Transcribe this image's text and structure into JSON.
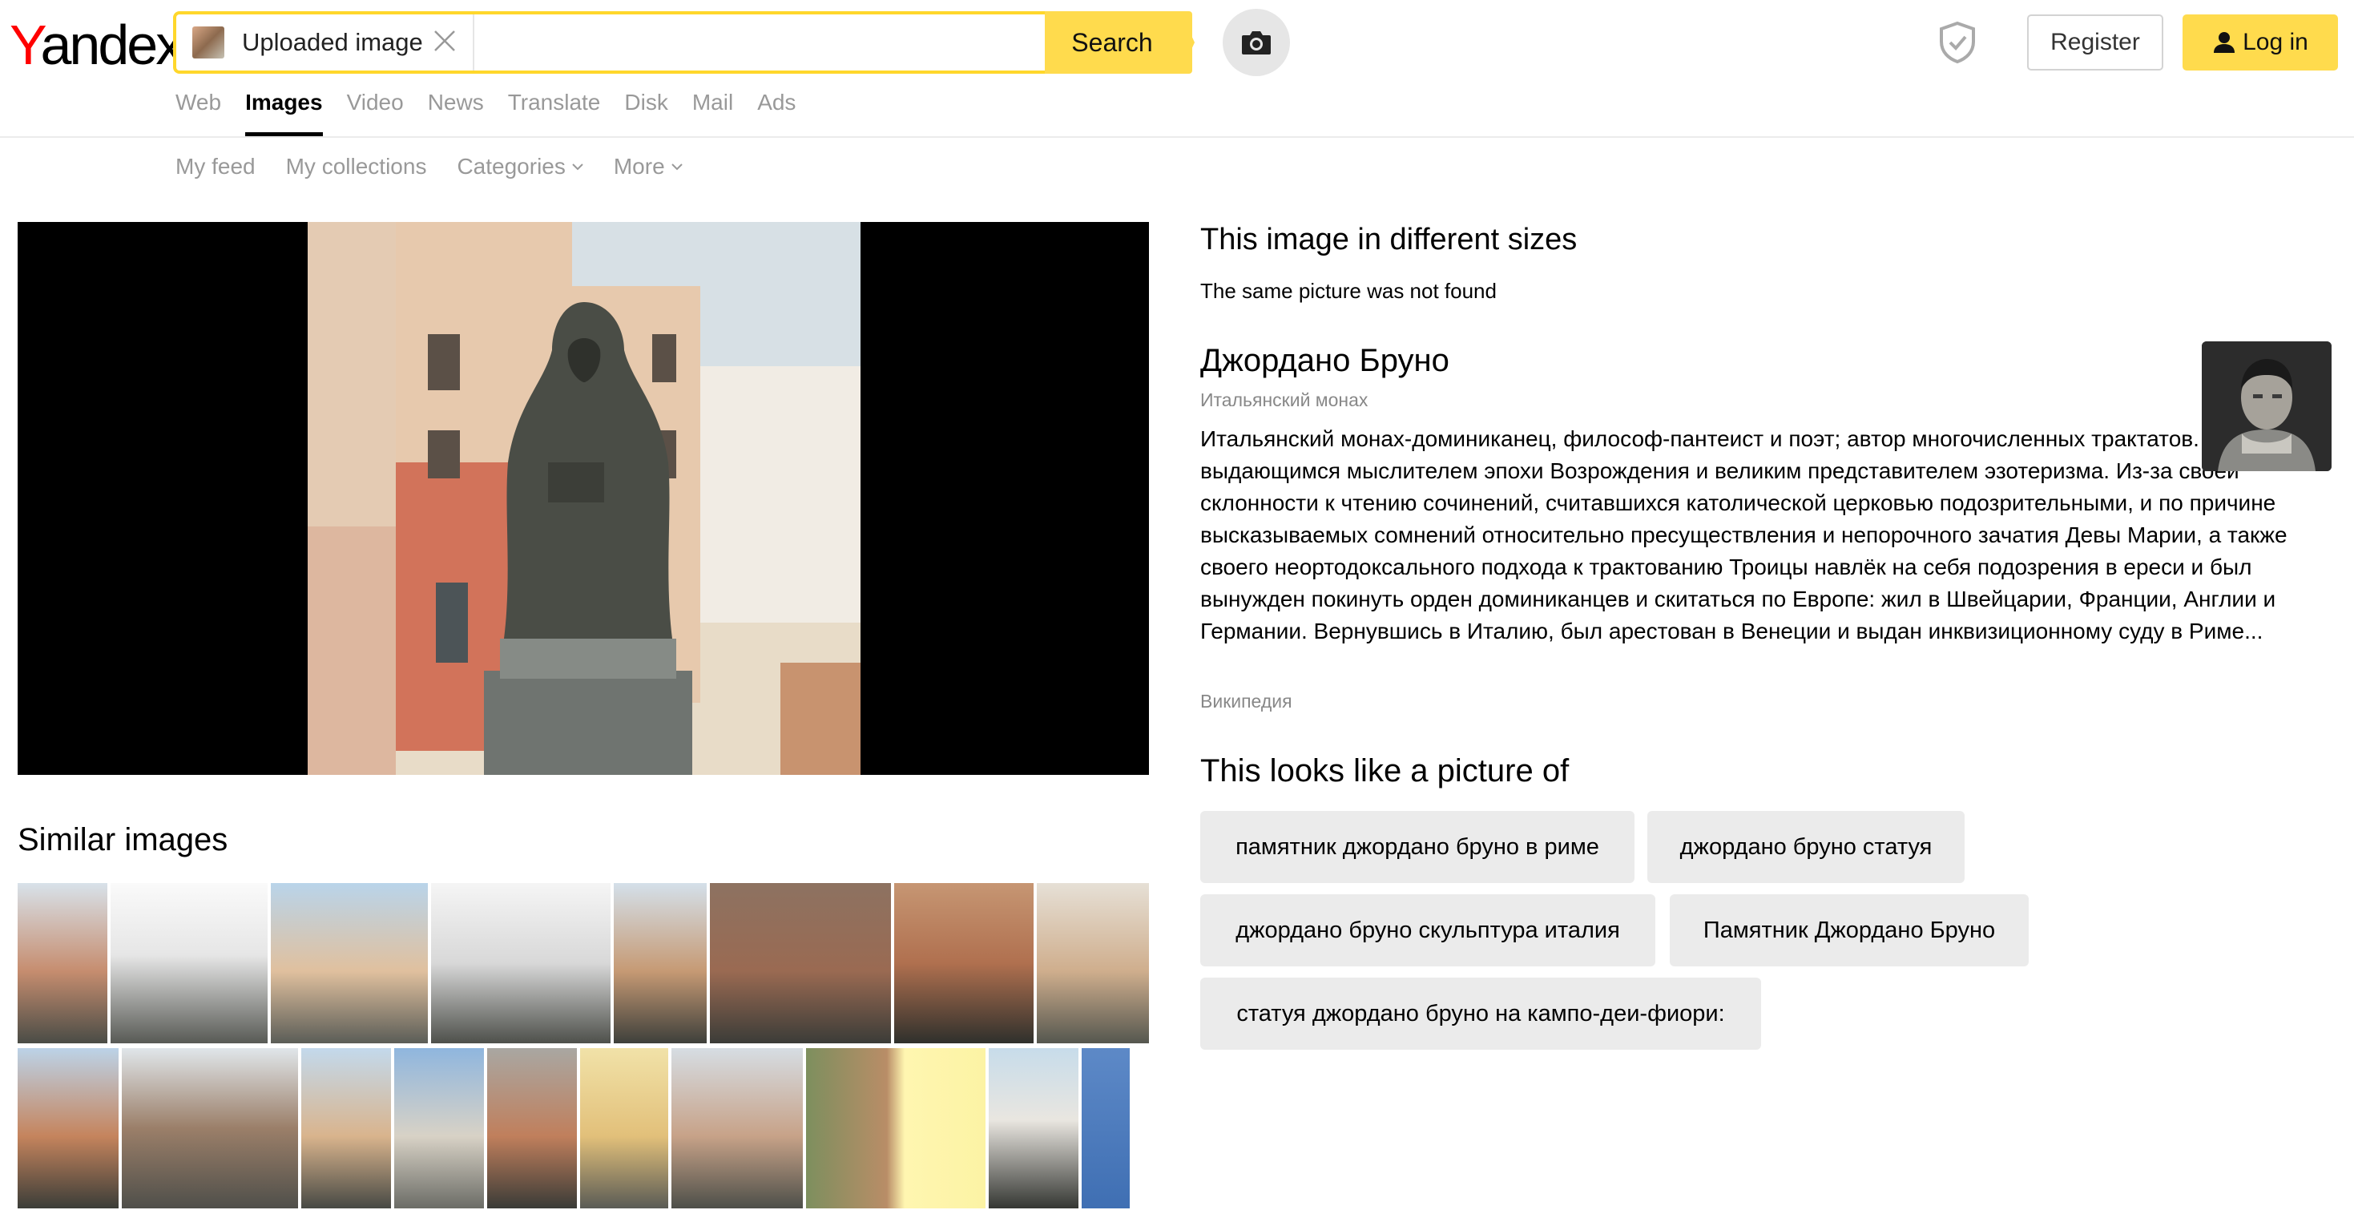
{
  "header": {
    "logo_first": "Y",
    "logo_rest": "andex",
    "search_chip_label": "Uploaded image",
    "search_button": "Search",
    "register_button": "Register",
    "login_button": "Log in",
    "accent": "#ffdb4d",
    "icons": [
      "close-icon",
      "camera-icon",
      "shield-icon",
      "user-icon"
    ]
  },
  "services": [
    {
      "label": "Web",
      "active": false
    },
    {
      "label": "Images",
      "active": true
    },
    {
      "label": "Video",
      "active": false
    },
    {
      "label": "News",
      "active": false
    },
    {
      "label": "Translate",
      "active": false
    },
    {
      "label": "Disk",
      "active": false
    },
    {
      "label": "Mail",
      "active": false
    },
    {
      "label": "Ads",
      "active": false
    }
  ],
  "subnav": [
    {
      "label": "My feed",
      "dropdown": false
    },
    {
      "label": "My collections",
      "dropdown": false
    },
    {
      "label": "Categories",
      "dropdown": true
    },
    {
      "label": "More",
      "dropdown": true
    }
  ],
  "similar": {
    "title": "Similar images"
  },
  "sizes": {
    "title": "This image in different sizes",
    "note": "The same picture was not found"
  },
  "entity": {
    "name": "Джордано Бруно",
    "subtitle": "Итальянский монах",
    "description": "Итальянский монах-доминиканец, философ-пантеист и поэт; автор многочисленных трактатов. Признан выдающимся мыслителем эпохи Возрождения и великим представителем эзотеризма. Из-за своей склонности к чтению сочинений, считавшихся католической церковью подозрительными, и по причине высказываемых сомнений относительно пресуществления и непорочного зачатия Девы Марии, а также своего неортодоксального подхода к трактованию Троицы навлёк на себя подозрения в ереси и был вынужден покинуть орден доминиканцев и скитаться по Европе: жил в Швейцарии, Франции, Англии и Германии. Вернувшись в Италию, был арестован в Венеции и выдан инквизиционному суду в Риме...",
    "source": "Википедия"
  },
  "looks_like": {
    "title": "This looks like a picture of",
    "tags": [
      "памятник джордано бруно в риме",
      "джордано бруно статуя",
      "джордано бруно скульптура италия",
      "Памятник Джордано Бруно",
      "статуя джордано бруно на кампо-деи-фиори:"
    ]
  }
}
